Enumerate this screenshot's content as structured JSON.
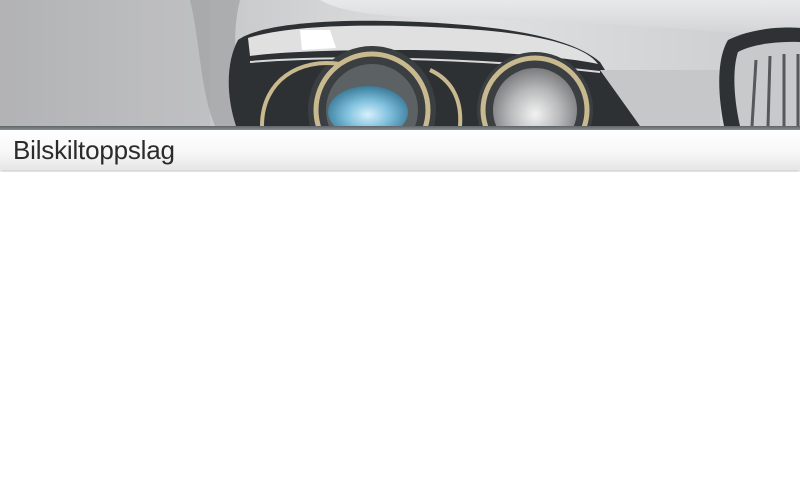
{
  "header": {
    "title": "Bilskiltoppslag",
    "banner_image": "car-headlight-photo"
  },
  "colors": {
    "banner_rule": "#6a7074",
    "title_text": "#2b2b2b",
    "background": "#ffffff"
  }
}
